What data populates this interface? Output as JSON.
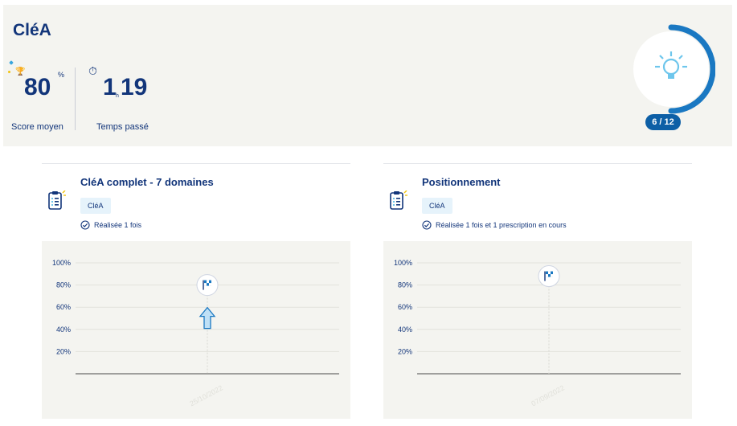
{
  "header": {
    "title": "CléA",
    "score": {
      "value": "80",
      "unit": "%",
      "label": "Score moyen"
    },
    "time": {
      "hours": "1",
      "hours_unit": "h",
      "minutes": "19",
      "label": "Temps passé"
    },
    "progress": {
      "text": "6 / 12",
      "done": 6,
      "total": 12
    }
  },
  "colors": {
    "primary": "#12357a",
    "accent": "#1a78c2",
    "badge": "#0d5fa6",
    "icon_light": "#6ec6ec",
    "panel_bg": "#f4f4f0"
  },
  "cards": [
    {
      "title": "CléA complet - 7 domaines",
      "tag": "CléA",
      "status": "Réalisée 1 fois",
      "chart_data": {
        "type": "scatter",
        "y_ticks": [
          "100%",
          "80%",
          "60%",
          "40%",
          "20%"
        ],
        "ylim": [
          0,
          100
        ],
        "points": [
          {
            "x": "25/10/2022",
            "y": 80
          }
        ],
        "arrow_up_marker": true
      }
    },
    {
      "title": "Positionnement",
      "tag": "CléA",
      "status": "Réalisée 1 fois et 1 prescription en cours",
      "chart_data": {
        "type": "scatter",
        "y_ticks": [
          "100%",
          "80%",
          "60%",
          "40%",
          "20%"
        ],
        "ylim": [
          0,
          100
        ],
        "points": [
          {
            "x": "07/09/2022",
            "y": 88
          }
        ],
        "arrow_up_marker": false
      }
    }
  ],
  "icons": {
    "score": "trophy-icon",
    "time": "stopwatch-icon",
    "progress": "lightbulb-icon",
    "card": "clipboard-checklist-icon",
    "status": "check-circle-icon",
    "point": "flag-icon"
  }
}
